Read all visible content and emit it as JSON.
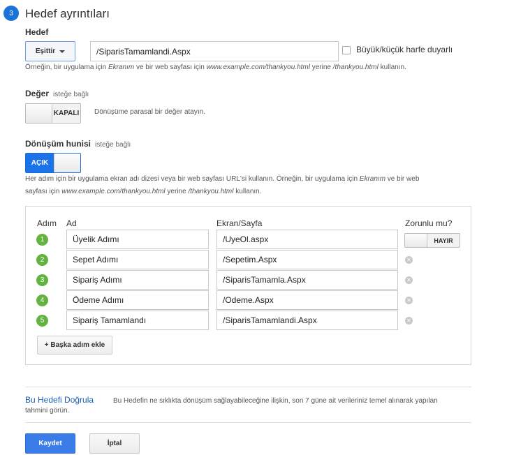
{
  "step": {
    "number": "3",
    "title": "Hedef ayrıntıları"
  },
  "destination": {
    "label": "Hedef",
    "match_type": "Eşittir",
    "value": "/SiparisTamamlandi.Aspx",
    "case_sensitive_label": "Büyük/küçük harfe duyarlı",
    "hint_prefix": "Örneğin, bir uygulama için ",
    "hint_app_example": "Ekranım",
    "hint_middle": " ve bir web sayfası için ",
    "hint_url_example": "www.example.com/thankyou.html",
    "hint_instead": " yerine ",
    "hint_path_example": "/thankyou.html",
    "hint_suffix": " kullanın."
  },
  "value_section": {
    "label": "Değer",
    "optional": "isteğe bağlı",
    "toggle": "KAPALI",
    "hint": "Dönüşüme parasal bir değer atayın."
  },
  "funnel_section": {
    "label": "Dönüşüm hunisi",
    "optional": "isteğe bağlı",
    "toggle": "AÇIK",
    "hint_1": "Her adım için bir uygulama ekran adı dizesi veya bir web sayfası URL'si kullanın. Örneğin, bir uygulama için ",
    "hint_app_example": "Ekranım",
    "hint_2": " ve bir web",
    "hint_3": "sayfası için ",
    "hint_url_example": "www.example.com/thankyou.html",
    "hint_instead": " yerine ",
    "hint_path_example": "/thankyou.html",
    "hint_suffix": " kullanın."
  },
  "funnel": {
    "headers": {
      "step": "Adım",
      "name": "Ad",
      "screen": "Ekran/Sayfa",
      "required": "Zorunlu mu?"
    },
    "required_toggle": "HAYIR",
    "steps": [
      {
        "num": "1",
        "name": "Üyelik Adımı",
        "page": "/UyeOl.aspx"
      },
      {
        "num": "2",
        "name": "Sepet Adımı",
        "page": "/Sepetim.Aspx"
      },
      {
        "num": "3",
        "name": "Sipariş Adımı",
        "page": "/SiparisTamamla.Aspx"
      },
      {
        "num": "4",
        "name": "Ödeme Adımı",
        "page": "/Odeme.Aspx"
      },
      {
        "num": "5",
        "name": "Sipariş Tamamlandı",
        "page": "/SiparisTamamlandi.Aspx"
      }
    ],
    "add_step": "+ Başka adım ekle"
  },
  "verify": {
    "link": "Bu Hedefi Doğrula",
    "desc_1": "Bu Hedefin ne sıklıkta dönüşüm sağlayabileceğine ilişkin, son 7 güne ait verileriniz temel alınarak yapılan",
    "desc_2": "tahmini görün."
  },
  "actions": {
    "save": "Kaydet",
    "cancel": "İptal"
  }
}
